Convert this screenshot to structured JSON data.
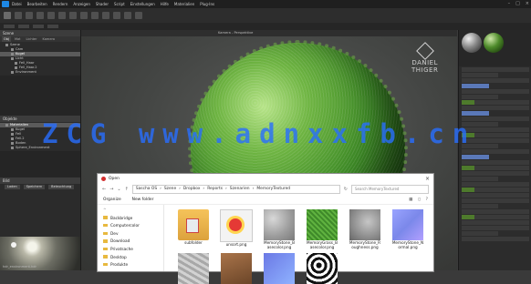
{
  "app": {
    "menu": [
      "Datei",
      "Bearbeiten",
      "Rendern",
      "Anzeigen",
      "Shader",
      "Script",
      "Einstellungen",
      "Hilfe",
      "Materialien",
      "Plug-Ins"
    ]
  },
  "leftpanel": {
    "header1": "Szene",
    "tabs": [
      "Obj",
      "Mat",
      "Lichter",
      "Kamera"
    ],
    "tree1": [
      {
        "label": "Szene",
        "level": 1,
        "selected": false
      },
      {
        "label": "Cam",
        "level": 2,
        "selected": false
      },
      {
        "label": "Kugel",
        "level": 2,
        "selected": true
      },
      {
        "label": "Licht",
        "level": 2,
        "selected": false
      },
      {
        "label": "Fell_Haar",
        "level": 3,
        "selected": false
      },
      {
        "label": "Fell_Haar.2",
        "level": 3,
        "selected": false
      },
      {
        "label": "Environment",
        "level": 2,
        "selected": false
      }
    ],
    "header2": "Objekte",
    "tree2": [
      {
        "label": "Materialien",
        "level": 1,
        "selected": true
      },
      {
        "label": "Kugel",
        "level": 2,
        "selected": false
      },
      {
        "label": "Fell",
        "level": 2,
        "selected": false
      },
      {
        "label": "Fell.2",
        "level": 2,
        "selected": false
      },
      {
        "label": "Boden",
        "level": 2,
        "selected": false
      },
      {
        "label": "Sphere_Environment",
        "level": 2,
        "selected": false
      }
    ],
    "header3": "Bild",
    "buttons": [
      "Laden",
      "Speichern",
      "Beleuchtung"
    ],
    "hdr_name": "hdr_environment.hdr"
  },
  "viewport": {
    "tab": "Kamera - Perspektive",
    "brand_line1": "DANIEL",
    "brand_line2": "THIGER"
  },
  "watermark": "ZCG www.adnxxfb.cn",
  "dialog": {
    "title": "Open",
    "breadcrumb": [
      "Sascha OS",
      "Szene",
      "Dropbox",
      "Reports",
      "Szenarien",
      "MemoryTextured"
    ],
    "search_placeholder": "Search MemoryTextured",
    "organize": "Organize",
    "new_folder": "New folder",
    "folders": [
      "Backbridge",
      "Computercolor",
      "Dev",
      "Download",
      "Privatsache",
      "Desktop",
      "Produkte"
    ],
    "files": [
      {
        "name": "subfolder",
        "kind": "folder"
      },
      {
        "name": "unsort.png",
        "kind": "doc"
      },
      {
        "name": "MemoryStone_Basecolor.png",
        "kind": "stone"
      },
      {
        "name": "MemoryGrass_Basecolor.png",
        "kind": "green"
      },
      {
        "name": "MemoryStone_Roughness.png",
        "kind": "rock"
      },
      {
        "name": "MemoryStone_Normal.png",
        "kind": "normal"
      },
      {
        "name": "",
        "kind": "grey"
      },
      {
        "name": "",
        "kind": "brown"
      },
      {
        "name": "",
        "kind": "blue"
      },
      {
        "name": "",
        "kind": "bw"
      }
    ]
  }
}
